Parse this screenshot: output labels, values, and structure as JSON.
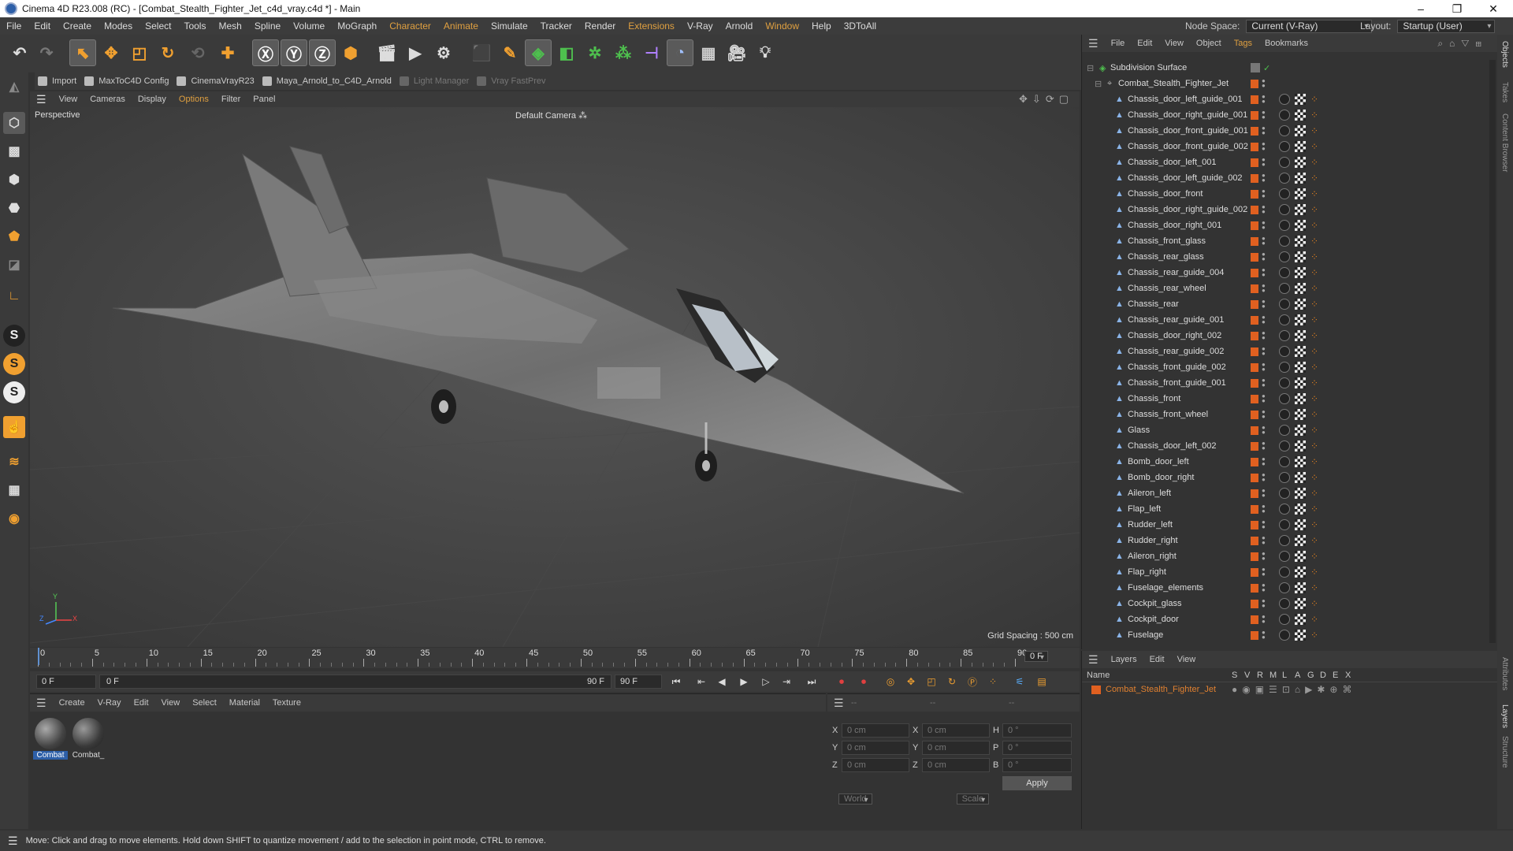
{
  "window": {
    "title": "Cinema 4D R23.008 (RC) - [Combat_Stealth_Fighter_Jet_c4d_vray.c4d *] - Main",
    "minimize": "–",
    "maximize": "❐",
    "close": "✕"
  },
  "menu": {
    "items": [
      "File",
      "Edit",
      "Create",
      "Modes",
      "Select",
      "Tools",
      "Mesh",
      "Spline",
      "Volume",
      "MoGraph",
      "Character",
      "Animate",
      "Simulate",
      "Tracker",
      "Render",
      "Extensions",
      "V-Ray",
      "Arnold",
      "Window",
      "Help",
      "3DToAll"
    ],
    "node_space_label": "Node Space:",
    "node_space_value": "Current (V-Ray)",
    "layout_label": "Layout:",
    "layout_value": "Startup (User)"
  },
  "plugins": {
    "items": [
      "Import",
      "MaxToC4D Config",
      "CinemaVrayR23",
      "Maya_Arnold_to_C4D_Arnold",
      "Light Manager",
      "Vray FastPrev"
    ]
  },
  "viewport": {
    "menu": [
      "View",
      "Cameras",
      "Display",
      "Options",
      "Filter",
      "Panel"
    ],
    "projection": "Perspective",
    "camera": "Default Camera",
    "camera_suffix": "⁂",
    "grid_spacing": "Grid Spacing : 500 cm",
    "axis_x": "X",
    "axis_y": "Y",
    "axis_z": "Z"
  },
  "timeline": {
    "ticks": [
      "0",
      "5",
      "10",
      "15",
      "20",
      "25",
      "30",
      "35",
      "40",
      "45",
      "50",
      "55",
      "60",
      "65",
      "70",
      "75",
      "80",
      "85",
      "90"
    ],
    "current_frame": "0 F",
    "start": "0 F",
    "slider_start": "0 F",
    "slider_end": "90 F",
    "end": "90 F"
  },
  "materials": {
    "menu": [
      "Create",
      "V-Ray",
      "Edit",
      "View",
      "Select",
      "Material",
      "Texture"
    ],
    "items": [
      "Combat",
      "Combat_"
    ]
  },
  "coords": {
    "header_dashes": [
      "--",
      "--",
      "--"
    ],
    "rows": [
      {
        "a": "X",
        "av": "0 cm",
        "b": "X",
        "bv": "0 cm",
        "c": "H",
        "cv": "0 °"
      },
      {
        "a": "Y",
        "av": "0 cm",
        "b": "Y",
        "bv": "0 cm",
        "c": "P",
        "cv": "0 °"
      },
      {
        "a": "Z",
        "av": "0 cm",
        "b": "Z",
        "bv": "0 cm",
        "c": "B",
        "cv": "0 °"
      }
    ],
    "world": "World",
    "scale": "Scale",
    "apply": "Apply"
  },
  "objects": {
    "menu": [
      "File",
      "Edit",
      "View",
      "Object",
      "Tags",
      "Bookmarks"
    ],
    "root": "Subdivision Surface",
    "group": "Combat_Stealth_Fighter_Jet",
    "children": [
      "Chassis_door_left_guide_001",
      "Chassis_door_right_guide_001",
      "Chassis_door_front_guide_001",
      "Chassis_door_front_guide_002",
      "Chassis_door_left_001",
      "Chassis_door_left_guide_002",
      "Chassis_door_front",
      "Chassis_door_right_guide_002",
      "Chassis_door_right_001",
      "Chassis_front_glass",
      "Chassis_rear_glass",
      "Chassis_rear_guide_004",
      "Chassis_rear_wheel",
      "Chassis_rear",
      "Chassis_rear_guide_001",
      "Chassis_door_right_002",
      "Chassis_rear_guide_002",
      "Chassis_front_guide_002",
      "Chassis_front_guide_001",
      "Chassis_front",
      "Chassis_front_wheel",
      "Glass",
      "Chassis_door_left_002",
      "Bomb_door_left",
      "Bomb_door_right",
      "Aileron_left",
      "Flap_left",
      "Rudder_left",
      "Rudder_right",
      "Aileron_right",
      "Flap_right",
      "Fuselage_elements",
      "Cockpit_glass",
      "Cockpit_door",
      "Fuselage"
    ]
  },
  "layers": {
    "menu": [
      "Layers",
      "Edit",
      "View"
    ],
    "col_name": "Name",
    "cols": [
      "S",
      "V",
      "R",
      "M",
      "L",
      "A",
      "G",
      "D",
      "E",
      "X"
    ],
    "items": [
      "Combat_Stealth_Fighter_Jet"
    ]
  },
  "side_tabs": [
    "Objects",
    "Takes",
    "Content Browser",
    "Attributes",
    "Layers",
    "Structure"
  ],
  "status": "Move: Click and drag to move elements. Hold down SHIFT to quantize movement / add to the selection in point mode, CTRL to remove.",
  "colors": {
    "accent": "#e06020",
    "highlight": "#e0a040",
    "selection": "#2d5fa8"
  }
}
